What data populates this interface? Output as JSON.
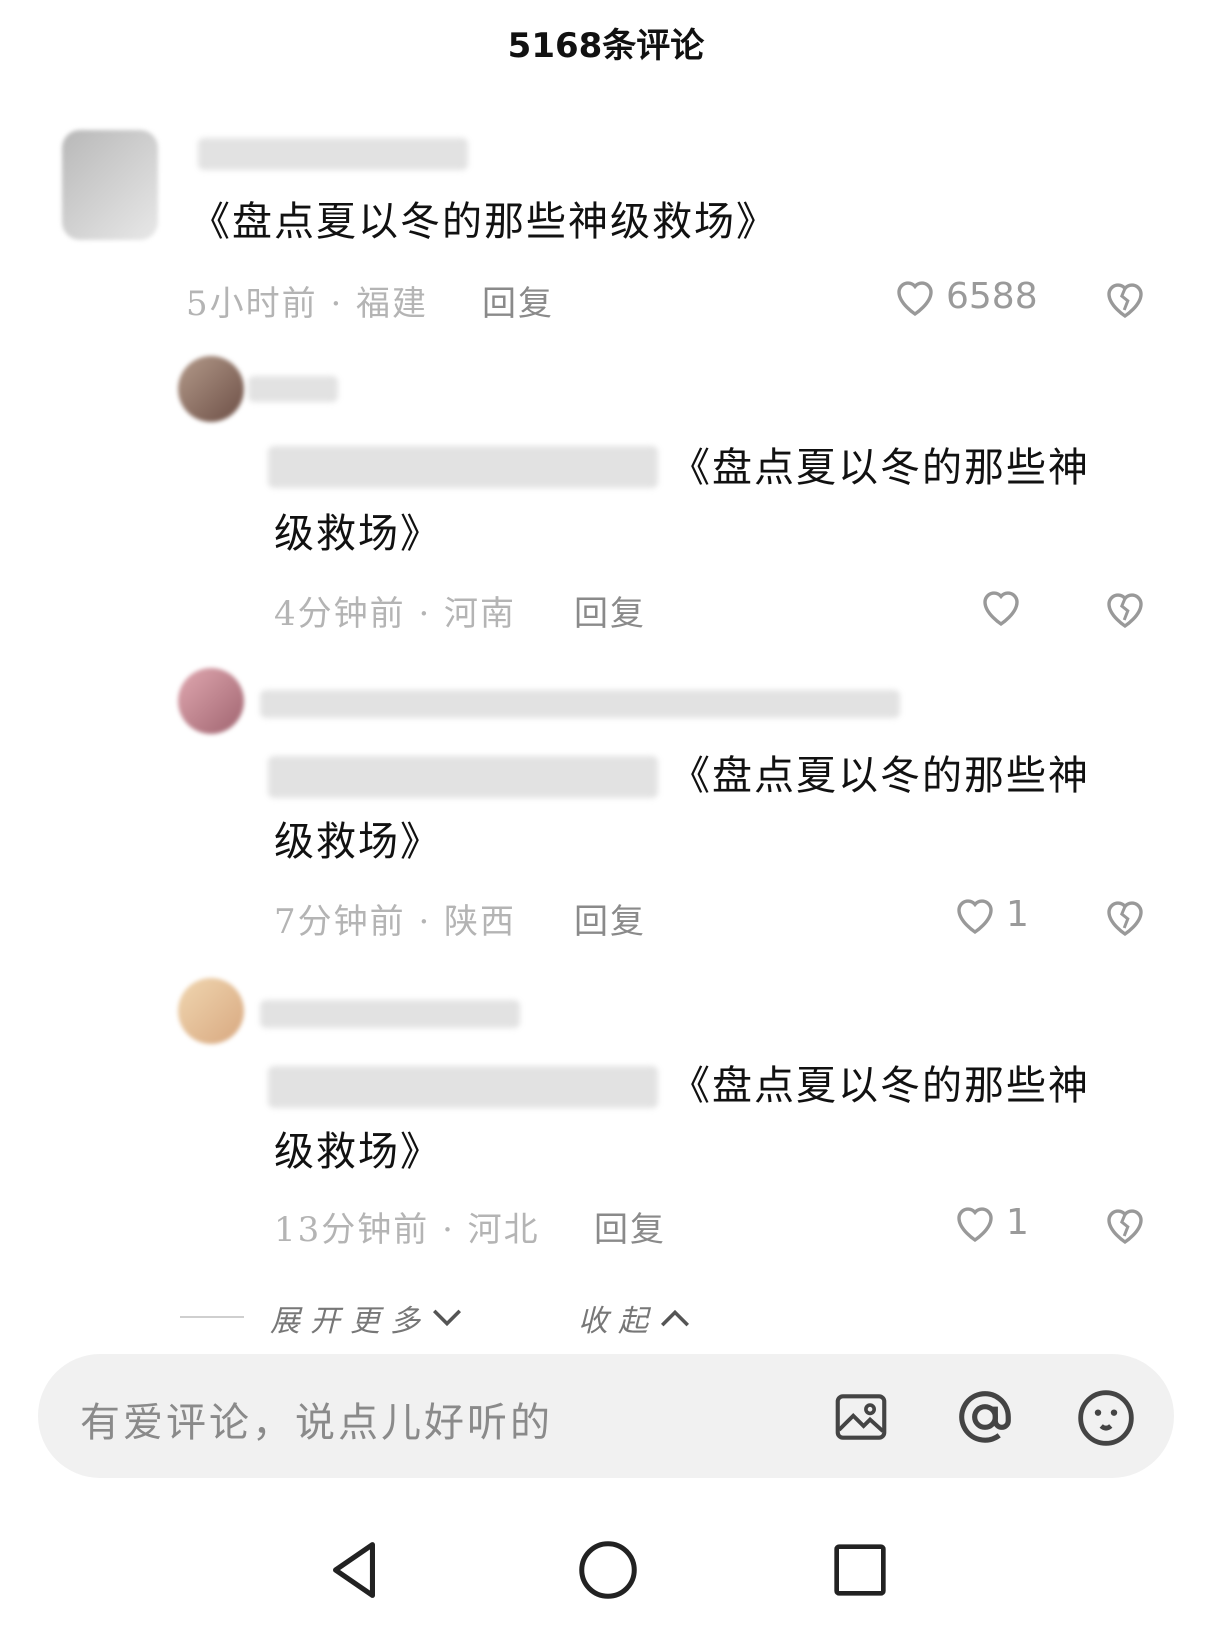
{
  "header": {
    "title": "5168条评论"
  },
  "comments": [
    {
      "text": "《盘点夏以冬的那些神级救场》",
      "meta": "5小时前 · 福建",
      "reply_label": "回复",
      "likes": "6588"
    },
    {
      "text_line1": "《盘点夏以冬的那些神",
      "text_line2": "级救场》",
      "meta": "4分钟前 · 河南",
      "reply_label": "回复",
      "likes": ""
    },
    {
      "text_line1": "《盘点夏以冬的那些神",
      "text_line2": "级救场》",
      "meta": "7分钟前 · 陕西",
      "reply_label": "回复",
      "likes": "1"
    },
    {
      "text_line1": "《盘点夏以冬的那些神",
      "text_line2": "级救场》",
      "meta": "13分钟前 · 河北",
      "reply_label": "回复",
      "likes": "1"
    }
  ],
  "thread_controls": {
    "expand_label": "展开更多",
    "collapse_label": "收起"
  },
  "input": {
    "placeholder": "有爱评论，说点儿好听的"
  },
  "icons": {
    "like": "heart-outline-icon",
    "dislike": "broken-heart-icon",
    "image": "image-icon",
    "mention": "at-icon",
    "emoji": "emoji-icon",
    "back": "triangle-back-icon",
    "home": "circle-home-icon",
    "recents": "square-recents-icon"
  }
}
